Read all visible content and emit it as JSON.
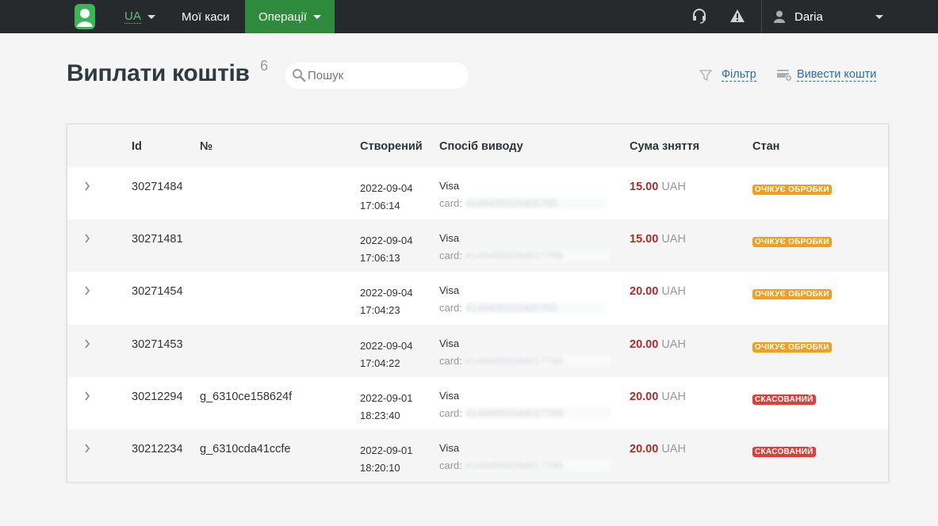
{
  "colors": {
    "topbar": "#262a2c",
    "accent_green": "#2e8b3e",
    "amount_red": "#b32a2a",
    "pending_orange": "#f0a020",
    "cancel_red": "#d9413a",
    "link_blue": "#2a6fa8"
  },
  "nav": {
    "logo_icon": "user-logo-icon",
    "lang": "UA",
    "my_cash": "Мої каси",
    "operations": "Операції",
    "support_icon": "headset-icon",
    "alert_icon": "warning-icon",
    "user_name": "Daria"
  },
  "page": {
    "title": "Виплати коштів",
    "count": "6",
    "search_placeholder": "Пошук",
    "filter_label": "Фільтр",
    "withdraw_label": "Вивести кошти"
  },
  "table": {
    "headers": {
      "id": "Id",
      "number": "№",
      "created": "Створений",
      "method": "Спосіб виводу",
      "amount": "Сума зняття",
      "state": "Стан"
    },
    "rows": [
      {
        "id": "30271484",
        "number": "",
        "date": "2022-09-04",
        "time": "17:06:14",
        "method": "Visa",
        "card_label": "card:",
        "card_mask": "4149435315405765",
        "amount": "15.00",
        "currency": "UAH",
        "state": "ОЧІКУЄ ОБРОБКИ",
        "state_type": "pending"
      },
      {
        "id": "30271481",
        "number": "",
        "date": "2022-09-04",
        "time": "17:06:13",
        "method": "Visa",
        "card_label": "card:",
        "card_mask": "4149495934d01779б",
        "amount": "15.00",
        "currency": "UAH",
        "state": "ОЧІКУЄ ОБРОБКИ",
        "state_type": "pending"
      },
      {
        "id": "30271454",
        "number": "",
        "date": "2022-09-04",
        "time": "17:04:23",
        "method": "Visa",
        "card_label": "card:",
        "card_mask": "4149435315405765",
        "amount": "20.00",
        "currency": "UAH",
        "state": "ОЧІКУЄ ОБРОБКИ",
        "state_type": "pending"
      },
      {
        "id": "30271453",
        "number": "",
        "date": "2022-09-04",
        "time": "17:04:22",
        "method": "Visa",
        "card_label": "card:",
        "card_mask": "4149495934d01779б",
        "amount": "20.00",
        "currency": "UAH",
        "state": "ОЧІКУЄ ОБРОБКИ",
        "state_type": "pending"
      },
      {
        "id": "30212294",
        "number": "g_6310ce158624f",
        "date": "2022-09-01",
        "time": "18:23:40",
        "method": "Visa",
        "card_label": "card:",
        "card_mask": "4149495934d01779б",
        "amount": "20.00",
        "currency": "UAH",
        "state": "СКАСОВАНИЙ",
        "state_type": "cancel"
      },
      {
        "id": "30212234",
        "number": "g_6310cda41ccfe",
        "date": "2022-09-01",
        "time": "18:20:10",
        "method": "Visa",
        "card_label": "card:",
        "card_mask": "4149495934d01779б",
        "amount": "20.00",
        "currency": "UAH",
        "state": "СКАСОВАНИЙ",
        "state_type": "cancel"
      }
    ]
  }
}
